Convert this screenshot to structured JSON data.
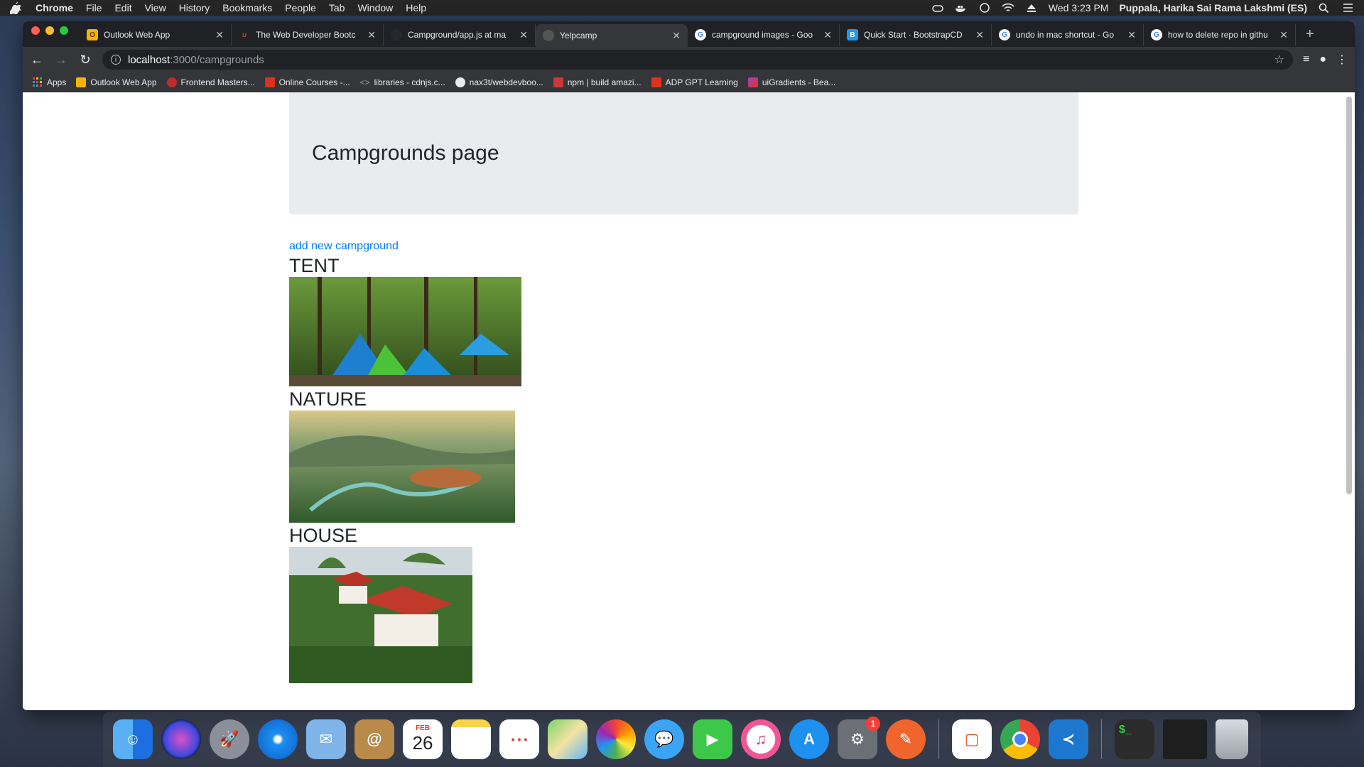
{
  "menubar": {
    "app_name": "Chrome",
    "items": [
      "File",
      "Edit",
      "View",
      "History",
      "Bookmarks",
      "People",
      "Tab",
      "Window",
      "Help"
    ],
    "clock": "Wed 3:23 PM",
    "user": "Puppala, Harika Sai Rama Lakshmi (ES)"
  },
  "tabs": [
    {
      "title": "Outlook Web App",
      "favicon_color": "#f5b400",
      "active": false
    },
    {
      "title": "The Web Developer Bootc",
      "favicon_color": "#e0311e",
      "active": false
    },
    {
      "title": "Campground/app.js at ma",
      "favicon_color": "#24292e",
      "active": false
    },
    {
      "title": "Yelpcamp",
      "favicon_color": "#555555",
      "active": true
    },
    {
      "title": "campground images - Goo",
      "favicon_color": "#4285f4",
      "active": false
    },
    {
      "title": "Quick Start · BootstrapCD",
      "favicon_color": "#1d9bf0",
      "active": false
    },
    {
      "title": "undo in mac shortcut - Go",
      "favicon_color": "#4285f4",
      "active": false
    },
    {
      "title": "how to delete repo in githu",
      "favicon_color": "#4285f4",
      "active": false
    }
  ],
  "address": {
    "host": "localhost",
    "path": ":3000/campgrounds"
  },
  "bookmarks": [
    {
      "label": "Apps",
      "color": "#e8453c"
    },
    {
      "label": "Outlook Web App",
      "color": "#f5b400"
    },
    {
      "label": "Frontend Masters...",
      "color": "#c02b2b"
    },
    {
      "label": "Online Courses -...",
      "color": "#e0311e"
    },
    {
      "label": "libraries - cdnjs.c...",
      "color": "#9aa0a6"
    },
    {
      "label": "nax3t/webdevboo...",
      "color": "#e8eaed"
    },
    {
      "label": "npm | build amazi...",
      "color": "#cb3837"
    },
    {
      "label": "ADP GPT Learning",
      "color": "#e0311e"
    },
    {
      "label": "uiGradients - Bea...",
      "color": "#a243c4"
    }
  ],
  "page": {
    "heading": "Campgrounds page",
    "add_link": "add new campground",
    "campgrounds": [
      {
        "name": "TENT"
      },
      {
        "name": "NATURE"
      },
      {
        "name": "HOUSE"
      }
    ]
  },
  "dock": {
    "calendar_month": "FEB",
    "calendar_day": "26",
    "sys_prefs_badge": "1"
  }
}
